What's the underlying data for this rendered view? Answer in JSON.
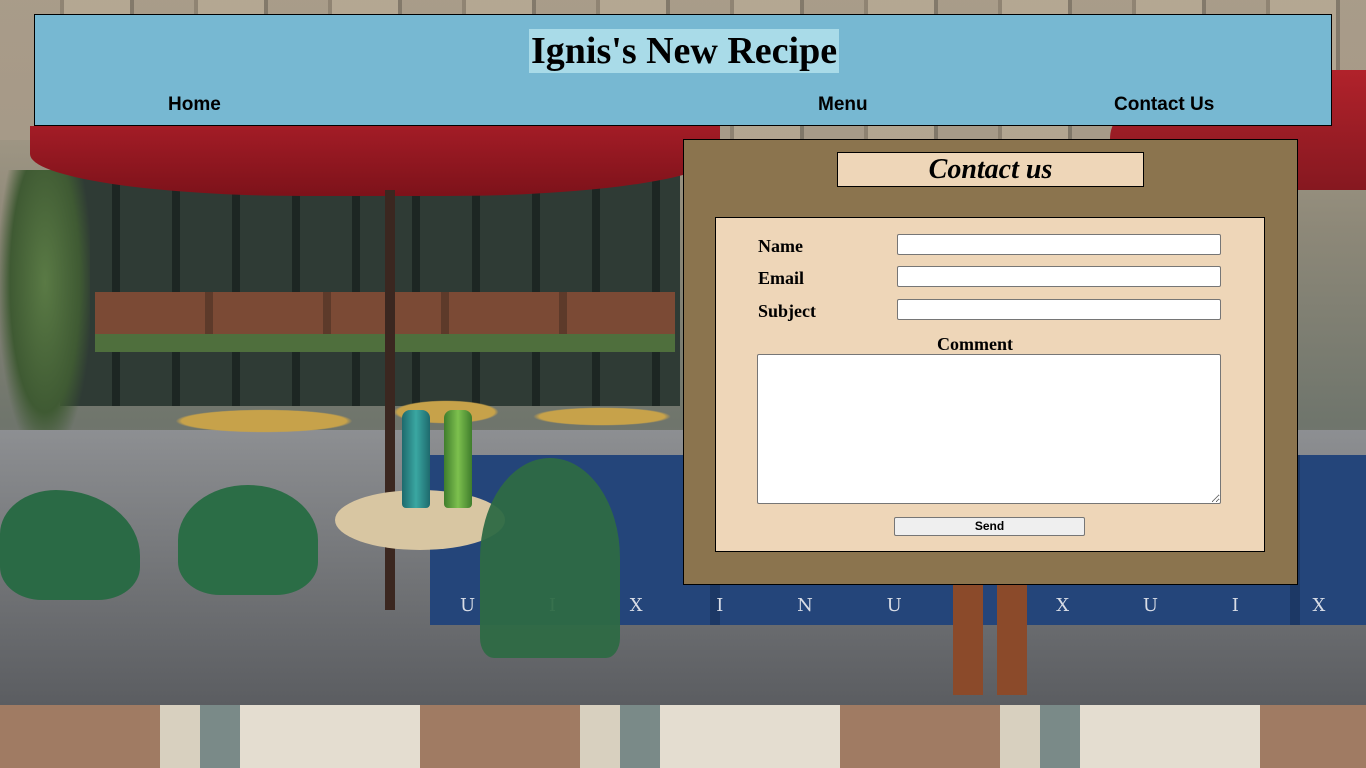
{
  "header": {
    "title": "Ignis's New Recipe",
    "nav": [
      {
        "label": "Home"
      },
      {
        "label": "Menu"
      },
      {
        "label": "Contact Us"
      }
    ]
  },
  "contact": {
    "title": "Contact us",
    "fields": {
      "name": {
        "label": "Name",
        "value": ""
      },
      "email": {
        "label": "Email",
        "value": ""
      },
      "subject": {
        "label": "Subject",
        "value": ""
      },
      "comment": {
        "label": "Comment",
        "value": ""
      }
    },
    "send_label": "Send"
  },
  "background": {
    "banner_text": "U I X I N U I X U I X"
  },
  "colors": {
    "header_bg": "#77b8d2",
    "title_highlight": "#a9dbe8",
    "panel_bg": "#8b744e",
    "form_bg": "#eed6b8"
  }
}
